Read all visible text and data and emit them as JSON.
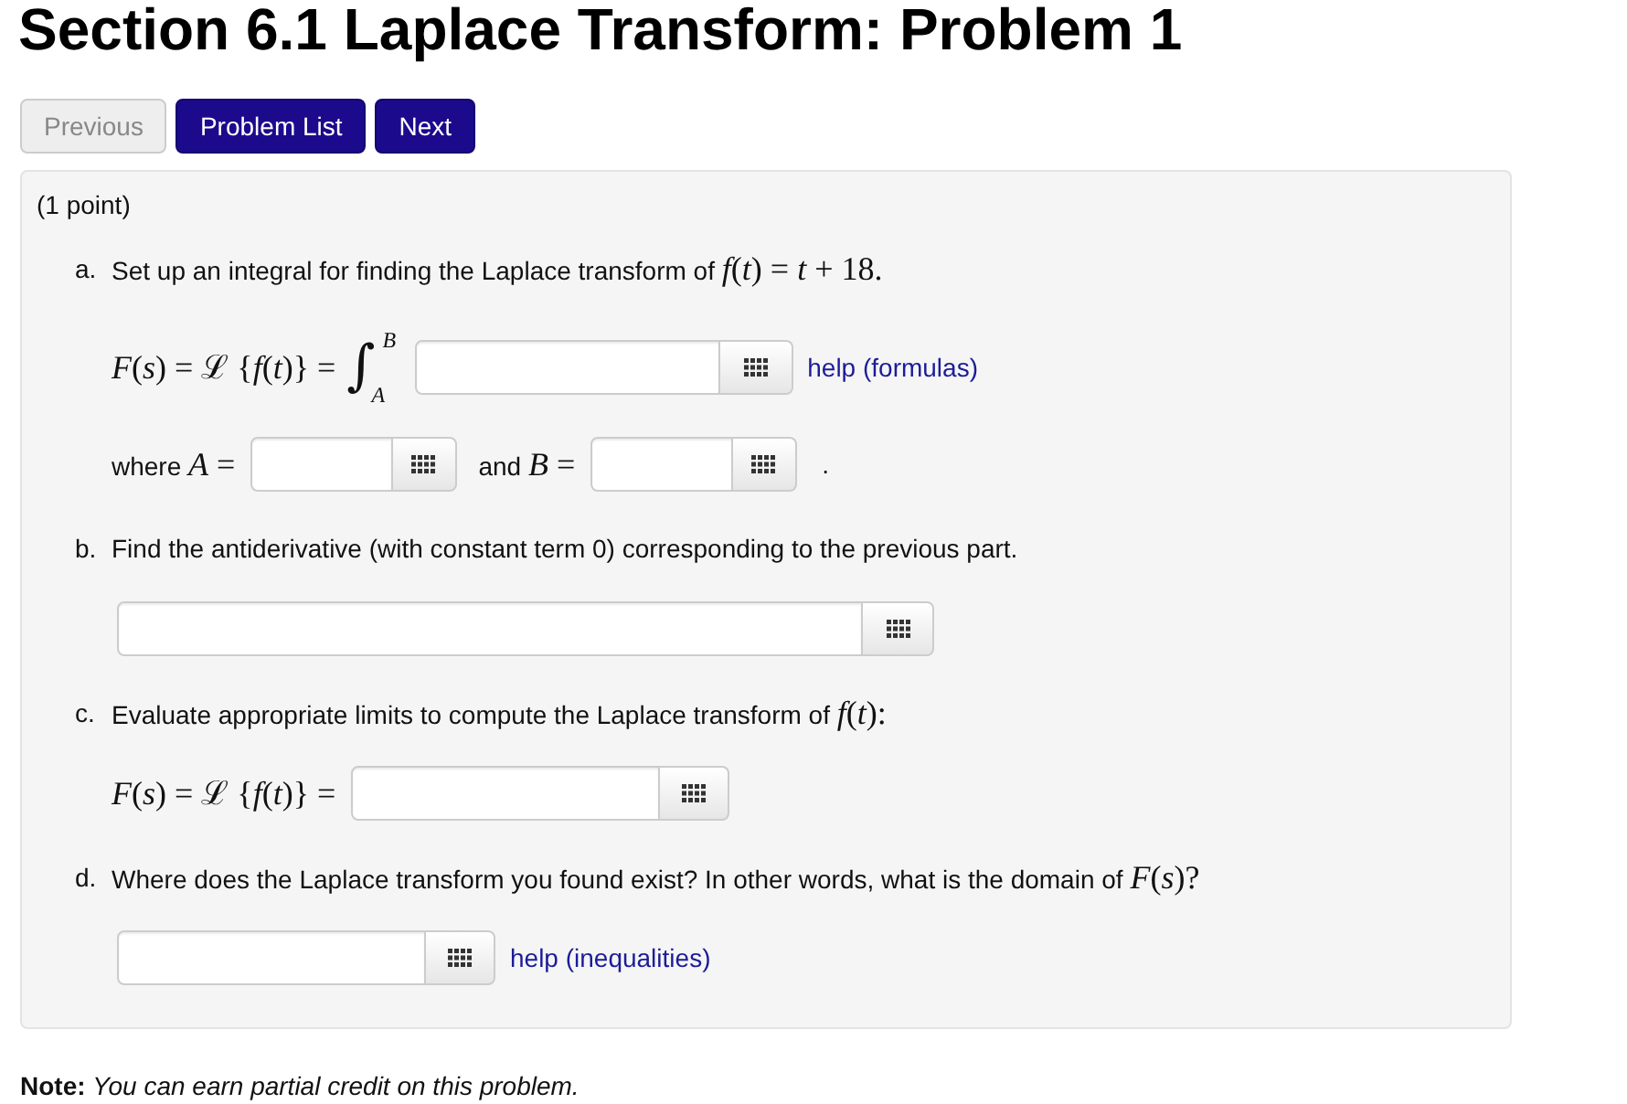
{
  "title": "Section 6.1 Laplace Transform: Problem 1",
  "nav_buttons": [
    {
      "label": "Previous",
      "disabled": true
    },
    {
      "label": "Problem List",
      "disabled": false
    },
    {
      "label": "Next",
      "disabled": false
    }
  ],
  "problem": {
    "points": "(1 point)",
    "blocks": [
      {
        "kind": "question",
        "marker": "a.",
        "text": "Set up an integral for finding the Laplace transform of",
        "math": "*f*(*t*) = *t* + 18."
      },
      {
        "kind": "integral",
        "lhs": "*F*(*s*) = ℒ {*f*(*t*)} =",
        "symbol": "∫",
        "upper": "B",
        "lower": "A",
        "help": "help (formulas)"
      },
      {
        "kind": "limits",
        "segments": [
          {
            "text": "where",
            "math": "*A* ="
          },
          {
            "text": "and",
            "math": "*B* ="
          }
        ],
        "end": "."
      },
      {
        "kind": "question",
        "marker": "b.",
        "text": "Find the antiderivative (with constant term 0) corresponding to the previous part."
      },
      {
        "kind": "wide_answer"
      },
      {
        "kind": "question",
        "marker": "c.",
        "text": "Evaluate appropriate limits to compute the Laplace transform of",
        "math": "*f*(*t*):"
      },
      {
        "kind": "answer",
        "lhs": "*F*(*s*) = ℒ {*f*(*t*)} ="
      },
      {
        "kind": "question",
        "marker": "d.",
        "text": "Where does the Laplace transform you found exist? In other words, what is the domain of",
        "math": "*F*(*s*)?"
      },
      {
        "kind": "answer",
        "help": "help (inequalities)"
      }
    ]
  },
  "note": "**Note:** *You can earn partial credit on this problem.*"
}
